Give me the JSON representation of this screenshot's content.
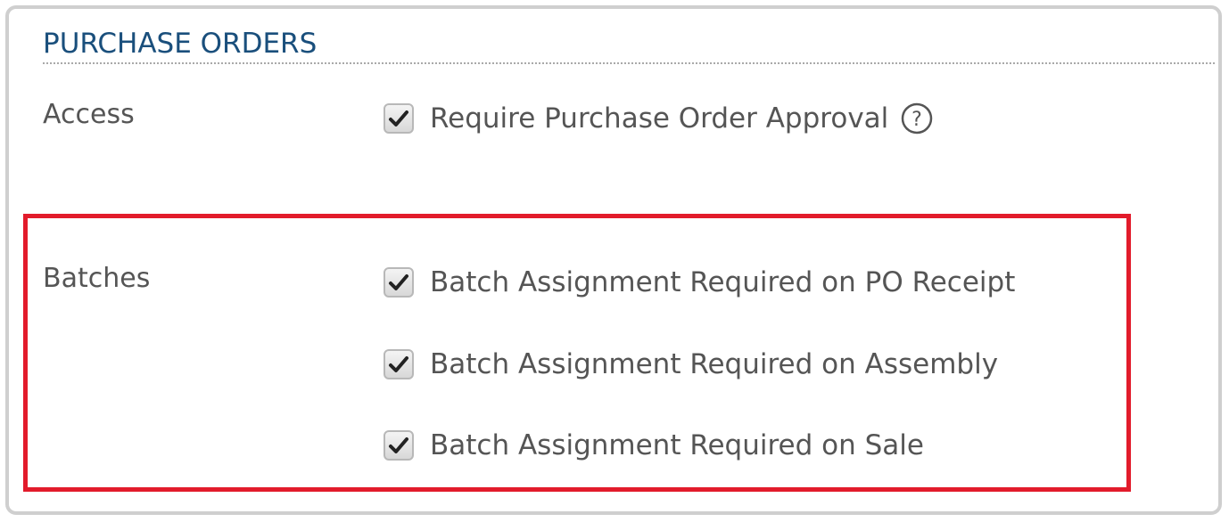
{
  "section": {
    "title": "PURCHASE ORDERS"
  },
  "access": {
    "label": "Access",
    "option": {
      "label": "Require Purchase Order Approval",
      "checked": true,
      "help_icon": "question-circle-icon"
    }
  },
  "batches": {
    "label": "Batches",
    "options": [
      {
        "label": "Batch Assignment Required on PO Receipt",
        "checked": true
      },
      {
        "label": "Batch Assignment Required on Assembly",
        "checked": true
      },
      {
        "label": "Batch Assignment Required on Sale",
        "checked": true
      }
    ]
  },
  "colors": {
    "title": "#1a4f7c",
    "text": "#555555",
    "highlight": "#e21b2b",
    "panel_border": "#cfcfcf"
  },
  "icons": {
    "checkbox": "checkmark-icon",
    "help": "question-circle-icon"
  }
}
